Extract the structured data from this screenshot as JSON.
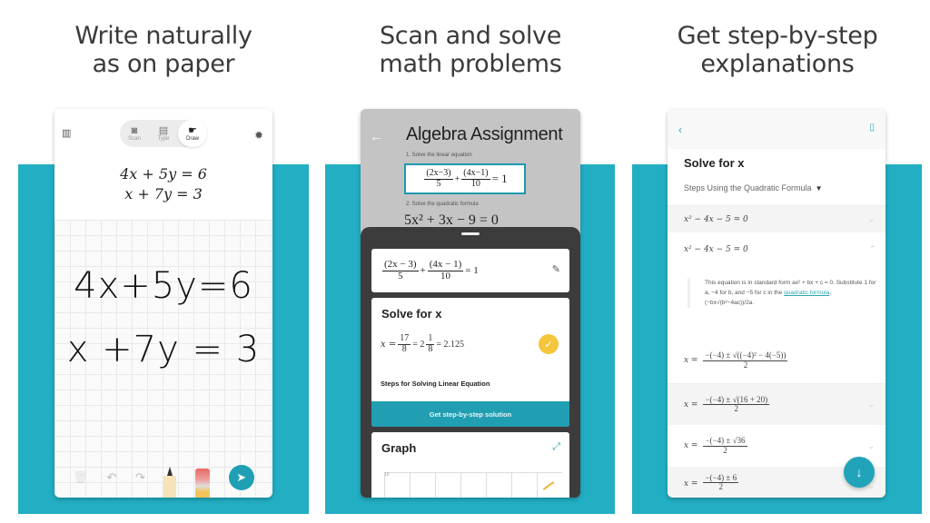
{
  "captions": [
    {
      "line1": "Write naturally",
      "line2": "as on paper"
    },
    {
      "line1": "Scan and solve",
      "line2": "math problems"
    },
    {
      "line1": "Get step-by-step",
      "line2": "explanations"
    }
  ],
  "colors": {
    "accent": "#22aec3",
    "button": "#219eb2",
    "check": "#f4c63c"
  },
  "phone1": {
    "modes": [
      {
        "label": "Scan",
        "icon": "camera-icon",
        "glyph": "◙"
      },
      {
        "label": "Type",
        "icon": "keyboard-icon",
        "glyph": "▤"
      },
      {
        "label": "Draw",
        "icon": "hand-draw-icon",
        "glyph": "☛",
        "active": true
      }
    ],
    "menu_glyph": "▥",
    "settings_glyph": "✹",
    "typeset": [
      "4x + 5y = 6",
      "x + 7y = 3"
    ],
    "handwriting": [
      "4x+5y=6",
      "x +7y = 3"
    ],
    "toolbar": {
      "delete": "🗑",
      "undo": "↶",
      "redo": "↷",
      "send": "➤"
    }
  },
  "phone2": {
    "back_glyph": "←",
    "title": "Algebra Assignment",
    "q1": "1. Solve the linear equation",
    "q1_eq": {
      "n1": "(2x−3)",
      "d1": "5",
      "plus": "+",
      "n2": "(4x−1)",
      "d2": "10",
      "rhs": "= 1"
    },
    "q2": "2. Solve the quadratic formula",
    "q2_eq": "5x² + 3x − 9 = 0",
    "equation_card": {
      "n1": "(2x − 3)",
      "d1": "5",
      "plus": "+",
      "n2": "(4x − 1)",
      "d2": "10",
      "rhs": "= 1",
      "edit_glyph": "✎"
    },
    "solve": {
      "title": "Solve for x",
      "lhs": "x =",
      "frac_num": "17",
      "frac_den": "8",
      "mixed": "= 2",
      "mixed_num": "1",
      "mixed_den": "8",
      "decimal": "= 2.125",
      "check_glyph": "✓",
      "steps_label": "Steps for Solving Linear Equation",
      "cta": "Get step-by-step solution"
    },
    "graph": {
      "title": "Graph",
      "expand_glyph": "⤢",
      "tick": "10"
    }
  },
  "phone3": {
    "back_glyph": "‹",
    "bookmark_glyph": "▯",
    "title": "Solve for x",
    "method": "Steps Using the Quadratic Formula",
    "method_caret": "▼",
    "steps": [
      {
        "text": "x² − 4x − 5 = 0",
        "chev": "⌄"
      },
      {
        "text": "x² − 4x − 5 = 0",
        "chev": "⌃"
      }
    ],
    "explanation": {
      "pre": "This equation is in standard form ax² + bx + c = 0. Substitute 1 for a, −4 for b, and −5 for c in the ",
      "link": "quadratic formula",
      "post": ", (−b±√(b²−4ac))/2a."
    },
    "formulas": [
      {
        "num": "−(−4) ± √((−4)² − 4(−5))",
        "den": "2"
      },
      {
        "num": "−(−4) ± √(16 + 20)",
        "den": "2",
        "chev": "⌄"
      },
      {
        "num": "−(−4) ± √36",
        "den": "2",
        "chev": "⌄"
      },
      {
        "num": "−(−4) ± 6",
        "den": "2",
        "chev": "⌄"
      }
    ],
    "lhs": "x =",
    "fab_glyph": "↓"
  }
}
